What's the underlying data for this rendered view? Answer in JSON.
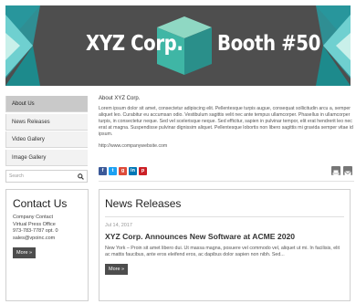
{
  "banner": {
    "title_left": "XYZ Corp.",
    "title_right": "Booth #50",
    "colors": {
      "background": "#4e4e4e",
      "teal": "#1b8d8f",
      "cube_top": "#8fd8c3",
      "cube_left": "#3fb6a5",
      "cube_right": "#2a8f8a"
    }
  },
  "nav": {
    "items": [
      {
        "label": "About Us",
        "active": true
      },
      {
        "label": "News Releases",
        "active": false
      },
      {
        "label": "Video Gallery",
        "active": false
      },
      {
        "label": "Image Gallery",
        "active": false
      }
    ]
  },
  "search": {
    "placeholder": "Search",
    "icon": "search-icon"
  },
  "contact": {
    "title": "Contact Us",
    "lines": [
      "Company Contact",
      "Virtual Press Office",
      "973-783-7787 opt. 0",
      "sales@vpoinc.com"
    ],
    "more_label": "More »"
  },
  "about": {
    "heading": "About XYZ Corp.",
    "body": "Lorem ipsum dolor sit amet, consectetur adipiscing elit. Pellentesque turpis augue, consequat sollicitudin arcu a, semper aliquet leo. Curabitur eu accumsan odio. Vestibulum sagittis velit nec ante tempus ullamcorper. Phasellus in ullamcorper turpis, in consectetur neque. Sed vel scelerisque neque. Sed efficitur, sapien in pulvinar tempor, elit erat hendrerit leo nec erat at magna. Suspendisse pulvinar dignissim aliquet. Pellentesque lobortis non libero sagittis mi gravida semper vitae id ipsum.",
    "link": "http://www.companywebsite.com"
  },
  "share": [
    {
      "icon": "facebook-icon",
      "glyph": "f",
      "color": "#3b5998"
    },
    {
      "icon": "twitter-icon",
      "glyph": "t",
      "color": "#1da1f2"
    },
    {
      "icon": "google-plus-icon",
      "glyph": "g",
      "color": "#dd4b39"
    },
    {
      "icon": "linkedin-icon",
      "glyph": "in",
      "color": "#0077b5"
    },
    {
      "icon": "pinterest-icon",
      "glyph": "p",
      "color": "#cb2027"
    }
  ],
  "news": {
    "title": "News Releases",
    "date": "Jul 14, 2017",
    "headline": "XYZ Corp. Announces New Software at ACME 2020",
    "excerpt": "New York – Proin sit amet libero dui. Ut massa magna, posuere vel commodo vel, aliquet ut mi. In facilisis, elit ac mattis faucibus, ante eros eleifend eros, ac dapibus dolor sapien non nibh. Sed...",
    "more_label": "More »"
  }
}
